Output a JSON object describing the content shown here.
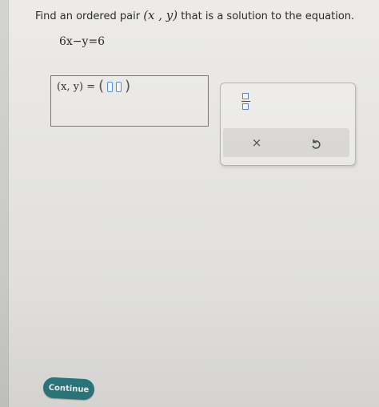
{
  "question": {
    "prefix": "Find an ordered pair",
    "pair": "(x , y)",
    "suffix": "that is a solution to the equation."
  },
  "equation": "6x−y=6",
  "answer": {
    "label": "(x, y) =",
    "open_paren": "(",
    "close_paren": ")"
  },
  "tools": {
    "fraction_icon": "fraction-icon",
    "clear_symbol": "×",
    "undo_icon": "undo-icon"
  },
  "footer": {
    "continue_label": "Continue"
  },
  "colors": {
    "accent": "#2f7f86",
    "slot_border": "#5a8fd0"
  }
}
